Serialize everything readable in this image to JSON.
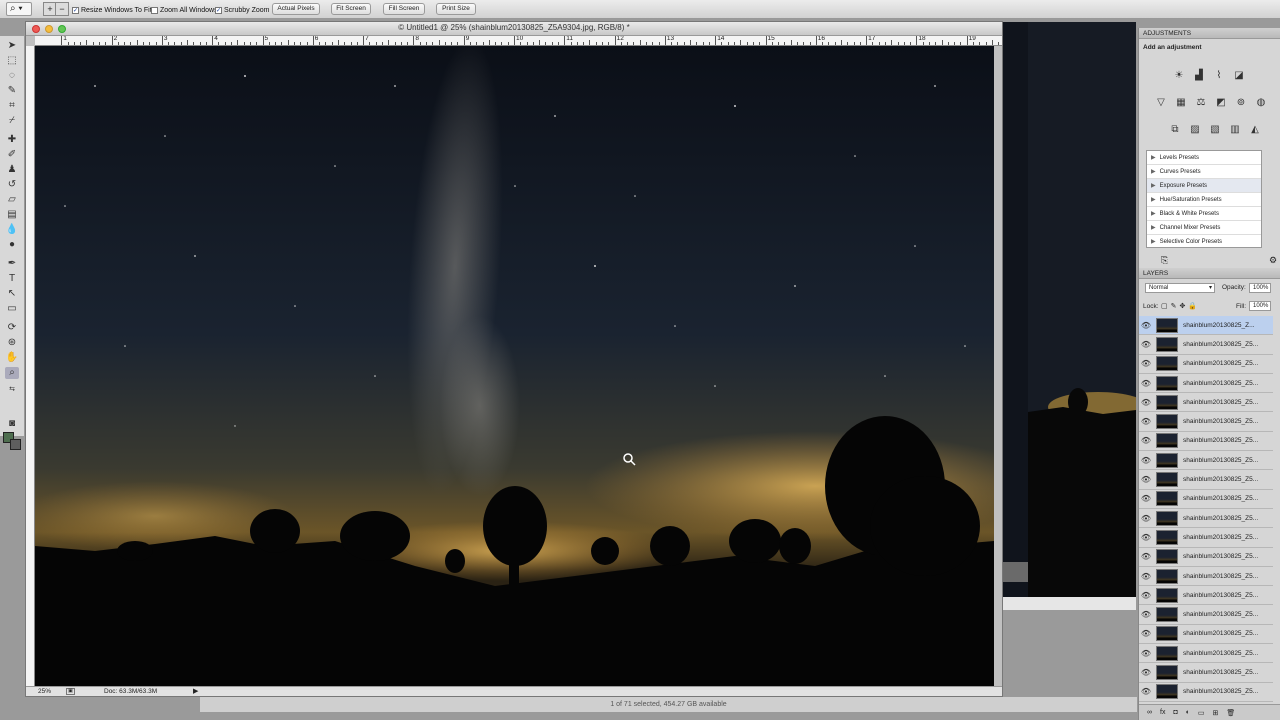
{
  "options_bar": {
    "tool_preset_icon": "magnifier-icon",
    "checkboxes": [
      {
        "label": "Resize Windows To Fit",
        "checked": true
      },
      {
        "label": "Zoom All Windows",
        "checked": false
      },
      {
        "label": "Scrubby Zoom",
        "checked": true
      }
    ],
    "buttons": [
      "Actual Pixels",
      "Fit Screen",
      "Fill Screen",
      "Print Size"
    ]
  },
  "document": {
    "title": "© Untitled1 @ 25% (shainblum20130825_Z5A9304.jpg, RGB/8) *",
    "zoom": "25%",
    "doc_size": "Doc: 63.3M/63.3M",
    "ruler_labels": [
      "1",
      "2",
      "3",
      "4",
      "5",
      "6",
      "7",
      "8",
      "9",
      "10",
      "11",
      "12",
      "13",
      "14",
      "15",
      "16",
      "17",
      "18",
      "19"
    ],
    "colors": {
      "foreground": "#4e6e4f",
      "background": "#5e5e5e"
    }
  },
  "finder_status": "1 of 71 selected, 454.27 GB available",
  "adjustments": {
    "title": "ADJUSTMENTS",
    "subtitle": "Add an adjustment",
    "presets": [
      "Levels Presets",
      "Curves Presets",
      "Exposure Presets",
      "Hue/Saturation Presets",
      "Black & White Presets",
      "Channel Mixer Presets",
      "Selective Color Presets"
    ]
  },
  "layers": {
    "title": "LAYERS",
    "blend_mode": "Normal",
    "opacity_label": "Opacity:",
    "opacity": "100%",
    "lock_label": "Lock:",
    "fill_label": "Fill:",
    "fill": "100%",
    "items": [
      "shainblum20130825_Z...",
      "shainblum20130825_Z5...",
      "shainblum20130825_Z5...",
      "shainblum20130825_Z5...",
      "shainblum20130825_Z5...",
      "shainblum20130825_Z5...",
      "shainblum20130825_Z5...",
      "shainblum20130825_Z5...",
      "shainblum20130825_Z5...",
      "shainblum20130825_Z5...",
      "shainblum20130825_Z5...",
      "shainblum20130825_Z5...",
      "shainblum20130825_Z5...",
      "shainblum20130825_Z5...",
      "shainblum20130825_Z5...",
      "shainblum20130825_Z5...",
      "shainblum20130825_Z5...",
      "shainblum20130825_Z5...",
      "shainblum20130825_Z5...",
      "shainblum20130825_Z5..."
    ]
  }
}
